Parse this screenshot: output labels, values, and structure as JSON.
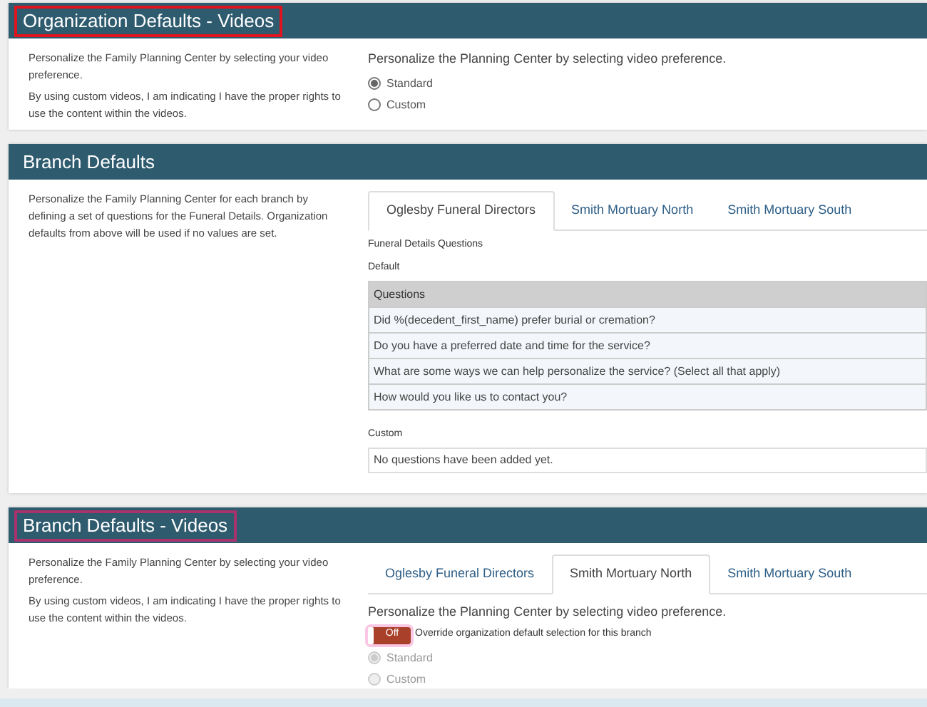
{
  "sections": [
    {
      "kind": "video_preference",
      "title": "Organization Defaults - Videos",
      "color": "#e0141e",
      "description": [
        "Personalize the Family Planning Center by selecting your video preference.",
        "By using custom videos, I am indicating I have the proper rights to use the content within the videos."
      ],
      "prompt": "Personalize the Planning Center by selecting video preference.",
      "options": [
        {
          "label": "Standard",
          "selected": true,
          "disabled": false
        },
        {
          "label": "Custom",
          "selected": false,
          "disabled": false
        }
      ]
    },
    {
      "kind": "questions",
      "title": "Branch Defaults",
      "description": [
        "Personalize the Family Planning Center for each branch by defining a set of questions for the Funeral Details. Organization defaults from above will be used if no values are set."
      ],
      "tabs": [
        {
          "label": "Oglesby Funeral Directors",
          "selected": true
        },
        {
          "label": "Smith Mortuary North",
          "selected": false
        },
        {
          "label": "Smith Mortuary South",
          "selected": false
        }
      ],
      "subheading": "Funeral Details Questions",
      "default_label": "Default",
      "table": {
        "column": "Questions",
        "rows": [
          "Did %(decedent_first_name) prefer burial or cremation?",
          "Do you have a preferred date and time for the service?",
          "What are some ways we can help personalize the service? (Select all that apply)",
          "How would you like us to contact you?"
        ]
      },
      "custom_label": "Custom",
      "custom_empty": "No questions have been added yet."
    },
    {
      "kind": "branch_video",
      "title": "Branch Defaults - Videos",
      "color": "#a8326e",
      "description": [
        "Personalize the Family Planning Center by selecting your video preference.",
        "By using custom videos, I am indicating I have the proper rights to use the content within the videos."
      ],
      "tabs": [
        {
          "label": "Oglesby Funeral Directors",
          "selected": false
        },
        {
          "label": "Smith Mortuary North",
          "selected": true
        },
        {
          "label": "Smith Mortuary South",
          "selected": false
        }
      ],
      "prompt": "Personalize the Planning Center by selecting video preference.",
      "toggle": {
        "label": "Off",
        "on": false,
        "caption": "Override organization default selection for this branch"
      },
      "options": [
        {
          "label": "Standard",
          "selected": true,
          "disabled": true
        },
        {
          "label": "Custom",
          "selected": false,
          "disabled": true
        }
      ]
    }
  ]
}
